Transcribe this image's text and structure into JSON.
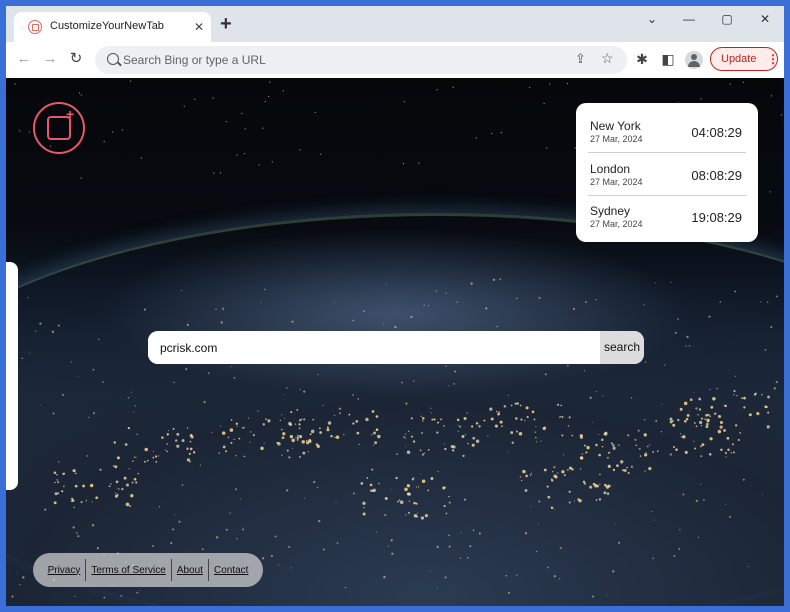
{
  "browser": {
    "tab_title": "CustomizeYourNewTab",
    "tab_close_glyph": "✕",
    "new_tab_glyph": "+",
    "window_controls": {
      "minimize": "⌄",
      "restore": "—",
      "maximize": "▢",
      "close": "✕"
    },
    "nav": {
      "back": "←",
      "forward": "→",
      "reload": "↻"
    },
    "omnibox_placeholder": "Search Bing or type a URL",
    "update_label": "Update",
    "update_menu_glyph": "⋮",
    "accent_color": "#c5221f",
    "progress_fraction": 0.61
  },
  "icons": {
    "favicon": "customize-tab-icon",
    "share": "share-icon",
    "star": "star-icon",
    "extensions": "puzzle-icon",
    "sidepanel": "side-panel-icon",
    "profile": "avatar-icon"
  },
  "clock_widget": {
    "entries": [
      {
        "city": "New York",
        "date": "27 Mar, 2024",
        "time": "04:08:29"
      },
      {
        "city": "London",
        "date": "27 Mar, 2024",
        "time": "08:08:29"
      },
      {
        "city": "Sydney",
        "date": "27 Mar, 2024",
        "time": "19:08:29"
      }
    ]
  },
  "search": {
    "value": "pcrisk.com",
    "button_label": "search"
  },
  "footer": {
    "links": [
      "Privacy",
      "Terms of Service",
      "About",
      "Contact"
    ]
  },
  "logo_color": "#e8576b"
}
